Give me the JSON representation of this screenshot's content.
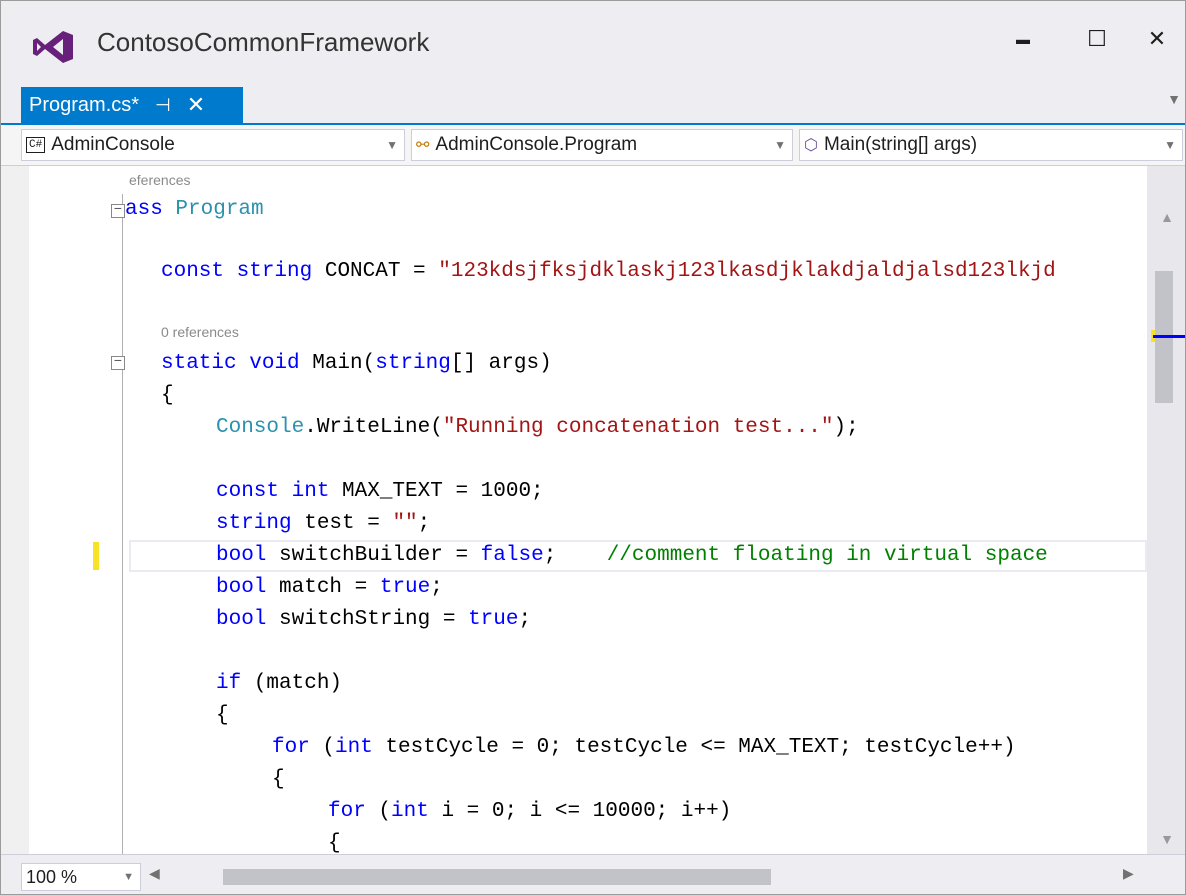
{
  "window": {
    "title": "ContosoCommonFramework",
    "minimize_glyph": "▬",
    "maximize_glyph": "☐",
    "close_glyph": "✕"
  },
  "tab": {
    "label": "Program.cs*",
    "pin_glyph": "⊣",
    "close_glyph": "✕"
  },
  "navbar": {
    "project": "AdminConsole",
    "type": "AdminConsole.Program",
    "member": "Main(string[] args)",
    "project_icon_text": "C#"
  },
  "code": {
    "lens_top": "eferences",
    "lens_main": "0 references",
    "class_kw": "ass",
    "class_name": "Program",
    "l_const_kw": "const string",
    "l_const_rest": " CONCAT = ",
    "l_const_str": "\"123kdsjfksjdklaskj123lkasdjklakdjaldjalsd123lkjd",
    "l_main_kw1": "static void",
    "l_main_rest1": " Main(",
    "l_main_kw2": "string",
    "l_main_rest2": "[] args)",
    "brace_open": "{",
    "l_console_type": "Console",
    "l_console_rest": ".WriteLine(",
    "l_console_str": "\"Running concatenation test...\"",
    "l_console_end": ");",
    "l_max_kw": "const int",
    "l_max_rest": " MAX_TEXT = 1000;",
    "l_test_kw": "string",
    "l_test_rest": " test = ",
    "l_test_str": "\"\"",
    "l_test_end": ";",
    "l_switch_kw": "bool",
    "l_switch_rest": " switchBuilder = ",
    "l_switch_val": "false",
    "l_switch_end": ";    ",
    "l_switch_cmt": "//comment floating in virtual space",
    "l_match_kw": "bool",
    "l_match_rest": " match = ",
    "l_match_val": "true",
    "l_match_end": ";",
    "l_sstr_kw": "bool",
    "l_sstr_rest": " switchString = ",
    "l_sstr_val": "true",
    "l_sstr_end": ";",
    "l_if_kw": "if",
    "l_if_rest": " (match)",
    "l_for1_kw": "for",
    "l_for1_a": " (",
    "l_for1_kw2": "int",
    "l_for1_rest": " testCycle = 0; testCycle <= MAX_TEXT; testCycle++)",
    "l_for2_kw": "for",
    "l_for2_a": " (",
    "l_for2_kw2": "int",
    "l_for2_rest": " i = 0; i <= 10000; i++)"
  },
  "statusbar": {
    "zoom": "100 %"
  },
  "colors": {
    "accent": "#007acc",
    "keyword": "#0000ff",
    "string": "#a31515",
    "type": "#2b91af",
    "comment": "#008000"
  },
  "icons": [
    "visual-studio-logo",
    "minimize-icon",
    "maximize-icon",
    "close-icon",
    "pin-icon",
    "csharp-project-icon",
    "class-icon",
    "method-icon",
    "split-icon"
  ]
}
